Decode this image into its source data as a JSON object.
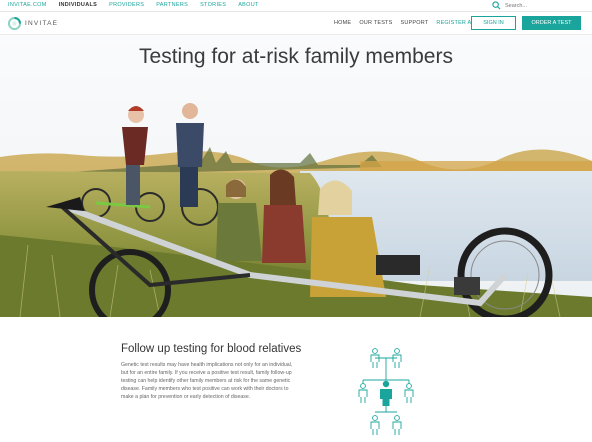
{
  "topbar": {
    "links": [
      {
        "label": "INVITAE.COM",
        "active": false
      },
      {
        "label": "INDIVIDUALS",
        "active": true
      },
      {
        "label": "PROVIDERS",
        "active": false
      },
      {
        "label": "PARTNERS",
        "active": false
      },
      {
        "label": "STORIES",
        "active": false
      },
      {
        "label": "ABOUT",
        "active": false
      }
    ],
    "search_placeholder": "Search..."
  },
  "nav": {
    "logo_text": "INVITAE",
    "menu": [
      {
        "label": "HOME"
      },
      {
        "label": "OUR TESTS"
      },
      {
        "label": "SUPPORT"
      },
      {
        "label": "REGISTER A TEST"
      }
    ],
    "signin_label": "SIGN IN",
    "order_label": "ORDER A TEST"
  },
  "hero": {
    "title": "Testing for at-risk family members"
  },
  "content": {
    "title": "Follow up testing for blood relatives",
    "body": "Genetic test results may have health implications not only for an individual, but for an entire family. If you receive a positive test result, family follow-up testing can help identify other family members at risk for the same genetic disease. Family members who test positive can work with their doctors to make a plan for prevention or early detection of disease."
  },
  "colors": {
    "brand": "#1aa59c",
    "text": "#333333"
  },
  "icons": {
    "search": "search-icon",
    "logo": "invitae-logo-icon",
    "family_tree": "family-tree-icon"
  }
}
